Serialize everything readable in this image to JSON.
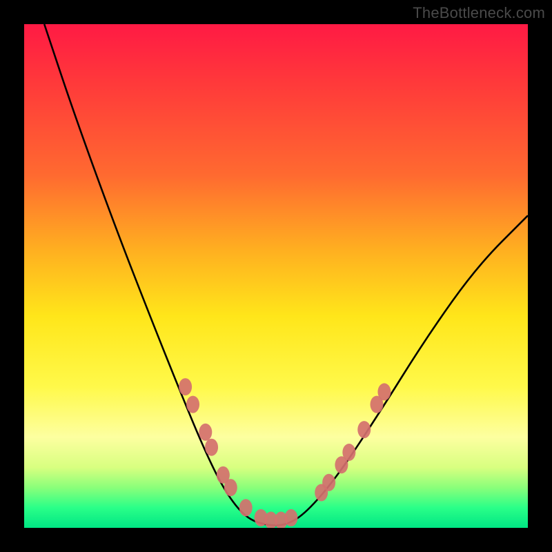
{
  "watermark": "TheBottleneck.com",
  "chart_data": {
    "type": "line",
    "title": "",
    "xlabel": "",
    "ylabel": "",
    "xlim": [
      0,
      100
    ],
    "ylim": [
      0,
      100
    ],
    "background_gradient": {
      "top_color": "#ff1a44",
      "bottom_color": "#00e684",
      "description": "vertical red-to-green gradient representing bottleneck severity"
    },
    "series": [
      {
        "name": "bottleneck-curve",
        "style": "black-line",
        "points": [
          {
            "x": 4,
            "y": 100
          },
          {
            "x": 10,
            "y": 82
          },
          {
            "x": 18,
            "y": 60
          },
          {
            "x": 25,
            "y": 42
          },
          {
            "x": 31,
            "y": 27
          },
          {
            "x": 36,
            "y": 15
          },
          {
            "x": 40,
            "y": 7
          },
          {
            "x": 44,
            "y": 2
          },
          {
            "x": 48,
            "y": 0.5
          },
          {
            "x": 52,
            "y": 0.5
          },
          {
            "x": 56,
            "y": 3
          },
          {
            "x": 62,
            "y": 10
          },
          {
            "x": 70,
            "y": 22
          },
          {
            "x": 80,
            "y": 38
          },
          {
            "x": 90,
            "y": 52
          },
          {
            "x": 100,
            "y": 62
          }
        ]
      },
      {
        "name": "highlighted-markers",
        "style": "salmon-ellipses",
        "color": "#d4706e",
        "points": [
          {
            "x": 32,
            "y": 28
          },
          {
            "x": 33.5,
            "y": 24.5
          },
          {
            "x": 36,
            "y": 19
          },
          {
            "x": 37.2,
            "y": 16
          },
          {
            "x": 39.5,
            "y": 10.5
          },
          {
            "x": 41,
            "y": 8
          },
          {
            "x": 44,
            "y": 4
          },
          {
            "x": 47,
            "y": 2
          },
          {
            "x": 49,
            "y": 1.5
          },
          {
            "x": 51,
            "y": 1.5
          },
          {
            "x": 53,
            "y": 2
          },
          {
            "x": 59,
            "y": 7
          },
          {
            "x": 60.5,
            "y": 9
          },
          {
            "x": 63,
            "y": 12.5
          },
          {
            "x": 64.5,
            "y": 15
          },
          {
            "x": 67.5,
            "y": 19.5
          },
          {
            "x": 70,
            "y": 24.5
          },
          {
            "x": 71.5,
            "y": 27
          }
        ]
      }
    ]
  }
}
